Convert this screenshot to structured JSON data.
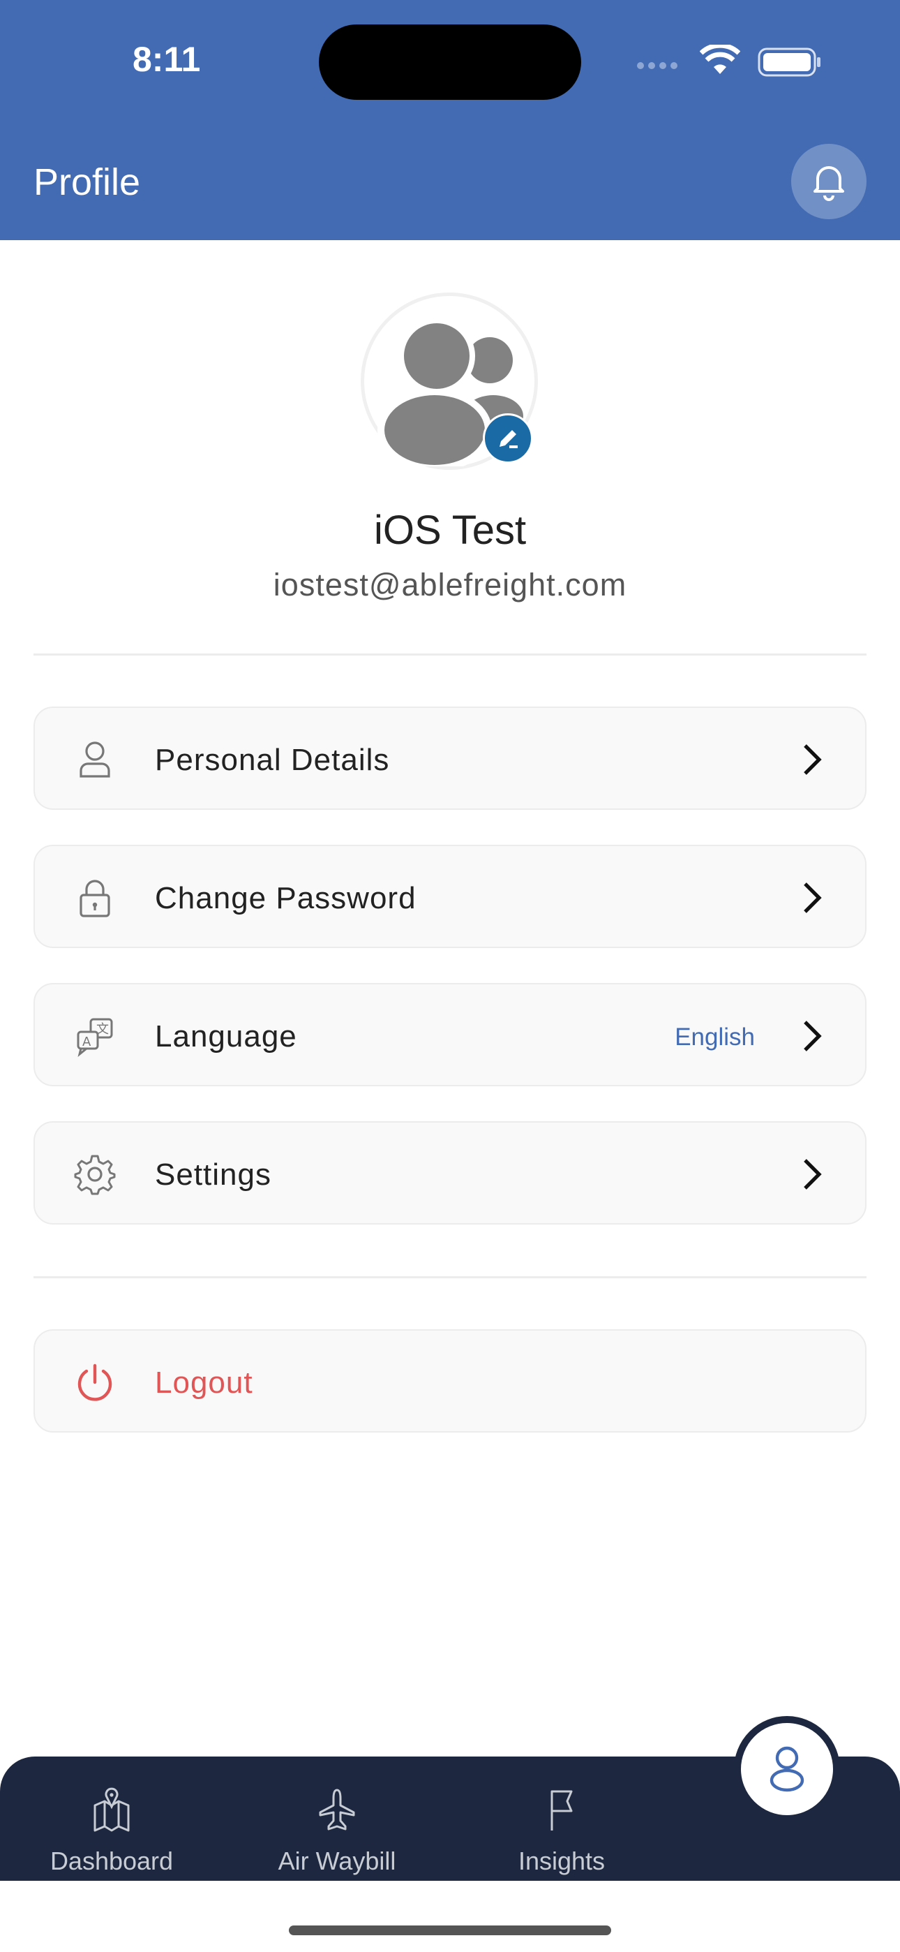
{
  "status_bar": {
    "time": "8:11"
  },
  "header": {
    "title": "Profile",
    "icon": "bell-icon"
  },
  "profile": {
    "name": "iOS Test",
    "email": "iostest@ablefreight.com"
  },
  "menu": [
    {
      "label": "Personal Details",
      "icon": "user-icon"
    },
    {
      "label": "Change Password",
      "icon": "lock-icon"
    },
    {
      "label": "Language",
      "icon": "translate-icon",
      "value": "English"
    },
    {
      "label": "Settings",
      "icon": "gear-icon"
    }
  ],
  "logout": {
    "label": "Logout",
    "icon": "power-icon",
    "color": "#e05555"
  },
  "tabs": [
    {
      "label": "Dashboard",
      "icon": "map-icon"
    },
    {
      "label": "Air Waybill",
      "icon": "airplane-icon"
    },
    {
      "label": "Insights",
      "icon": "flag-icon"
    },
    {
      "label": "",
      "icon": "user-icon",
      "active": true
    }
  ],
  "colors": {
    "primary": "#426bb3",
    "tabbar": "#1d2840",
    "edit_badge": "#1a6aa6"
  }
}
